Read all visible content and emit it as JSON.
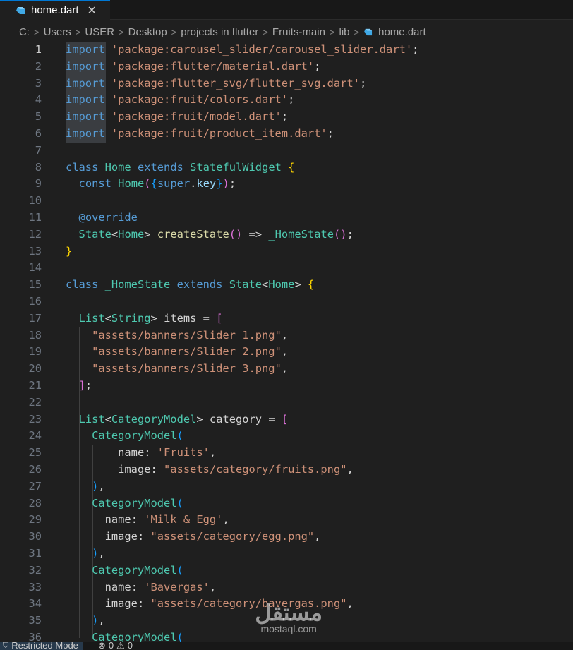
{
  "tab": {
    "filename": "home.dart",
    "close": "✕"
  },
  "breadcrumb": [
    "C:",
    "Users",
    "USER",
    "Desktop",
    "projects in flutter",
    "Fruits-main",
    "lib",
    "home.dart"
  ],
  "code_lines": [
    [
      {
        "t": "import",
        "c": "kw"
      },
      {
        "t": " ",
        "c": "plain"
      },
      {
        "t": "'package:carousel_slider/carousel_slider.dart'",
        "c": "str"
      },
      {
        "t": ";",
        "c": "plain"
      }
    ],
    [
      {
        "t": "import",
        "c": "kw"
      },
      {
        "t": " ",
        "c": "plain"
      },
      {
        "t": "'package:flutter/material.dart'",
        "c": "str"
      },
      {
        "t": ";",
        "c": "plain"
      }
    ],
    [
      {
        "t": "import",
        "c": "kw"
      },
      {
        "t": " ",
        "c": "plain"
      },
      {
        "t": "'package:flutter_svg/flutter_svg.dart'",
        "c": "str"
      },
      {
        "t": ";",
        "c": "plain"
      }
    ],
    [
      {
        "t": "import",
        "c": "kw"
      },
      {
        "t": " ",
        "c": "plain"
      },
      {
        "t": "'package:fruit/colors.dart'",
        "c": "str"
      },
      {
        "t": ";",
        "c": "plain"
      }
    ],
    [
      {
        "t": "import",
        "c": "kw"
      },
      {
        "t": " ",
        "c": "plain"
      },
      {
        "t": "'package:fruit/model.dart'",
        "c": "str"
      },
      {
        "t": ";",
        "c": "plain"
      }
    ],
    [
      {
        "t": "import",
        "c": "kw"
      },
      {
        "t": " ",
        "c": "plain"
      },
      {
        "t": "'package:fruit/product_item.dart'",
        "c": "str"
      },
      {
        "t": ";",
        "c": "plain"
      }
    ],
    [],
    [
      {
        "t": "class",
        "c": "kw"
      },
      {
        "t": " ",
        "c": "plain"
      },
      {
        "t": "Home",
        "c": "cls"
      },
      {
        "t": " ",
        "c": "plain"
      },
      {
        "t": "extends",
        "c": "kw"
      },
      {
        "t": " ",
        "c": "plain"
      },
      {
        "t": "StatefulWidget",
        "c": "cls"
      },
      {
        "t": " ",
        "c": "plain"
      },
      {
        "t": "{",
        "c": "b1"
      }
    ],
    [
      {
        "t": "  ",
        "c": "plain"
      },
      {
        "t": "const",
        "c": "kw"
      },
      {
        "t": " ",
        "c": "plain"
      },
      {
        "t": "Home",
        "c": "cls"
      },
      {
        "t": "(",
        "c": "b2"
      },
      {
        "t": "{",
        "c": "b3"
      },
      {
        "t": "super",
        "c": "kw"
      },
      {
        "t": ".",
        "c": "plain"
      },
      {
        "t": "key",
        "c": "var"
      },
      {
        "t": "}",
        "c": "b3"
      },
      {
        "t": ")",
        "c": "b2"
      },
      {
        "t": ";",
        "c": "plain"
      }
    ],
    [],
    [
      {
        "t": "  ",
        "c": "plain"
      },
      {
        "t": "@override",
        "c": "kw"
      }
    ],
    [
      {
        "t": "  ",
        "c": "plain"
      },
      {
        "t": "State",
        "c": "cls"
      },
      {
        "t": "<",
        "c": "plain"
      },
      {
        "t": "Home",
        "c": "cls"
      },
      {
        "t": "> ",
        "c": "plain"
      },
      {
        "t": "createState",
        "c": "fn"
      },
      {
        "t": "()",
        "c": "b2"
      },
      {
        "t": " => ",
        "c": "plain"
      },
      {
        "t": "_HomeState",
        "c": "cls"
      },
      {
        "t": "()",
        "c": "b2"
      },
      {
        "t": ";",
        "c": "plain"
      }
    ],
    [
      {
        "t": "}",
        "c": "b1"
      }
    ],
    [],
    [
      {
        "t": "class",
        "c": "kw"
      },
      {
        "t": " ",
        "c": "plain"
      },
      {
        "t": "_HomeState",
        "c": "cls"
      },
      {
        "t": " ",
        "c": "plain"
      },
      {
        "t": "extends",
        "c": "kw"
      },
      {
        "t": " ",
        "c": "plain"
      },
      {
        "t": "State",
        "c": "cls"
      },
      {
        "t": "<",
        "c": "plain"
      },
      {
        "t": "Home",
        "c": "cls"
      },
      {
        "t": ">",
        "c": "plain"
      },
      {
        "t": " ",
        "c": "plain"
      },
      {
        "t": "{",
        "c": "b1"
      }
    ],
    [],
    [
      {
        "t": "  ",
        "c": "plain"
      },
      {
        "t": "List",
        "c": "cls"
      },
      {
        "t": "<",
        "c": "plain"
      },
      {
        "t": "String",
        "c": "cls"
      },
      {
        "t": "> ",
        "c": "plain"
      },
      {
        "t": "items",
        "c": "plain"
      },
      {
        "t": " = ",
        "c": "plain"
      },
      {
        "t": "[",
        "c": "b2"
      }
    ],
    [
      {
        "t": "    ",
        "c": "plain"
      },
      {
        "t": "\"assets/banners/Slider 1.png\"",
        "c": "str"
      },
      {
        "t": ",",
        "c": "plain"
      }
    ],
    [
      {
        "t": "    ",
        "c": "plain"
      },
      {
        "t": "\"assets/banners/Slider 2.png\"",
        "c": "str"
      },
      {
        "t": ",",
        "c": "plain"
      }
    ],
    [
      {
        "t": "    ",
        "c": "plain"
      },
      {
        "t": "\"assets/banners/Slider 3.png\"",
        "c": "str"
      },
      {
        "t": ",",
        "c": "plain"
      }
    ],
    [
      {
        "t": "  ",
        "c": "plain"
      },
      {
        "t": "]",
        "c": "b2"
      },
      {
        "t": ";",
        "c": "plain"
      }
    ],
    [],
    [
      {
        "t": "  ",
        "c": "plain"
      },
      {
        "t": "List",
        "c": "cls"
      },
      {
        "t": "<",
        "c": "plain"
      },
      {
        "t": "CategoryModel",
        "c": "cls"
      },
      {
        "t": "> ",
        "c": "plain"
      },
      {
        "t": "category",
        "c": "plain"
      },
      {
        "t": " = ",
        "c": "plain"
      },
      {
        "t": "[",
        "c": "b2"
      }
    ],
    [
      {
        "t": "    ",
        "c": "plain"
      },
      {
        "t": "CategoryModel",
        "c": "cls"
      },
      {
        "t": "(",
        "c": "b3"
      }
    ],
    [
      {
        "t": "        ",
        "c": "plain"
      },
      {
        "t": "name",
        "c": "plain"
      },
      {
        "t": ": ",
        "c": "plain"
      },
      {
        "t": "'Fruits'",
        "c": "str"
      },
      {
        "t": ",",
        "c": "plain"
      }
    ],
    [
      {
        "t": "        ",
        "c": "plain"
      },
      {
        "t": "image",
        "c": "plain"
      },
      {
        "t": ": ",
        "c": "plain"
      },
      {
        "t": "\"assets/category/fruits.png\"",
        "c": "str"
      },
      {
        "t": ",",
        "c": "plain"
      }
    ],
    [
      {
        "t": "    ",
        "c": "plain"
      },
      {
        "t": ")",
        "c": "b3"
      },
      {
        "t": ",",
        "c": "plain"
      }
    ],
    [
      {
        "t": "    ",
        "c": "plain"
      },
      {
        "t": "CategoryModel",
        "c": "cls"
      },
      {
        "t": "(",
        "c": "b3"
      }
    ],
    [
      {
        "t": "      ",
        "c": "plain"
      },
      {
        "t": "name",
        "c": "plain"
      },
      {
        "t": ": ",
        "c": "plain"
      },
      {
        "t": "'Milk & Egg'",
        "c": "str"
      },
      {
        "t": ",",
        "c": "plain"
      }
    ],
    [
      {
        "t": "      ",
        "c": "plain"
      },
      {
        "t": "image",
        "c": "plain"
      },
      {
        "t": ": ",
        "c": "plain"
      },
      {
        "t": "\"assets/category/egg.png\"",
        "c": "str"
      },
      {
        "t": ",",
        "c": "plain"
      }
    ],
    [
      {
        "t": "    ",
        "c": "plain"
      },
      {
        "t": ")",
        "c": "b3"
      },
      {
        "t": ",",
        "c": "plain"
      }
    ],
    [
      {
        "t": "    ",
        "c": "plain"
      },
      {
        "t": "CategoryModel",
        "c": "cls"
      },
      {
        "t": "(",
        "c": "b3"
      }
    ],
    [
      {
        "t": "      ",
        "c": "plain"
      },
      {
        "t": "name",
        "c": "plain"
      },
      {
        "t": ": ",
        "c": "plain"
      },
      {
        "t": "'Bavergas'",
        "c": "str"
      },
      {
        "t": ",",
        "c": "plain"
      }
    ],
    [
      {
        "t": "      ",
        "c": "plain"
      },
      {
        "t": "image",
        "c": "plain"
      },
      {
        "t": ": ",
        "c": "plain"
      },
      {
        "t": "\"assets/category/bavergas.png\"",
        "c": "str"
      },
      {
        "t": ",",
        "c": "plain"
      }
    ],
    [
      {
        "t": "    ",
        "c": "plain"
      },
      {
        "t": ")",
        "c": "b3"
      },
      {
        "t": ",",
        "c": "plain"
      }
    ],
    [
      {
        "t": "    ",
        "c": "plain"
      },
      {
        "t": "CategoryModel",
        "c": "cls"
      },
      {
        "t": "(",
        "c": "b3"
      }
    ]
  ],
  "active_line": 1,
  "watermark": {
    "arabic": "مستقل",
    "latin": "mostaql.com"
  },
  "status": {
    "restricted": "Restricted Mode",
    "errors": "0",
    "warnings": "0"
  },
  "colors": {
    "accent": "#0078d4",
    "background": "#1f1f1f",
    "restricted_bg": "#27394b"
  }
}
